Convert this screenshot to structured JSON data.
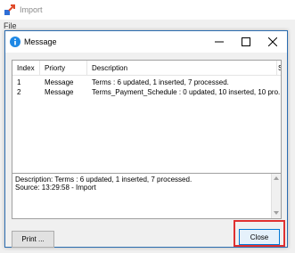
{
  "app": {
    "title": "Import",
    "icon": "import-app-icon"
  },
  "menubar": {
    "file": "File"
  },
  "dialog": {
    "title": "Message",
    "icon": "info-icon",
    "controls": {
      "minimize": "minimize-icon",
      "maximize": "maximize-icon",
      "close": "close-icon"
    }
  },
  "listview": {
    "columns": [
      "Index",
      "Priorty",
      "Description",
      "S"
    ],
    "rows": [
      {
        "index": "1",
        "priority": "Message",
        "description": "Terms : 6 updated, 1 inserted, 7 processed."
      },
      {
        "index": "2",
        "priority": "Message",
        "description": "Terms_Payment_Schedule : 0 updated, 10 inserted, 10 pro..."
      }
    ],
    "selected_row": 0
  },
  "details": {
    "line1": "Description: Terms : 6 updated, 1 inserted, 7 processed.",
    "line2": "Source:   13:29:58 - Import"
  },
  "buttons": {
    "print": "Print ...",
    "close": "Close"
  },
  "colors": {
    "accent": "#0078d7",
    "highlight": "#e03030",
    "info": "#1e88e5"
  }
}
